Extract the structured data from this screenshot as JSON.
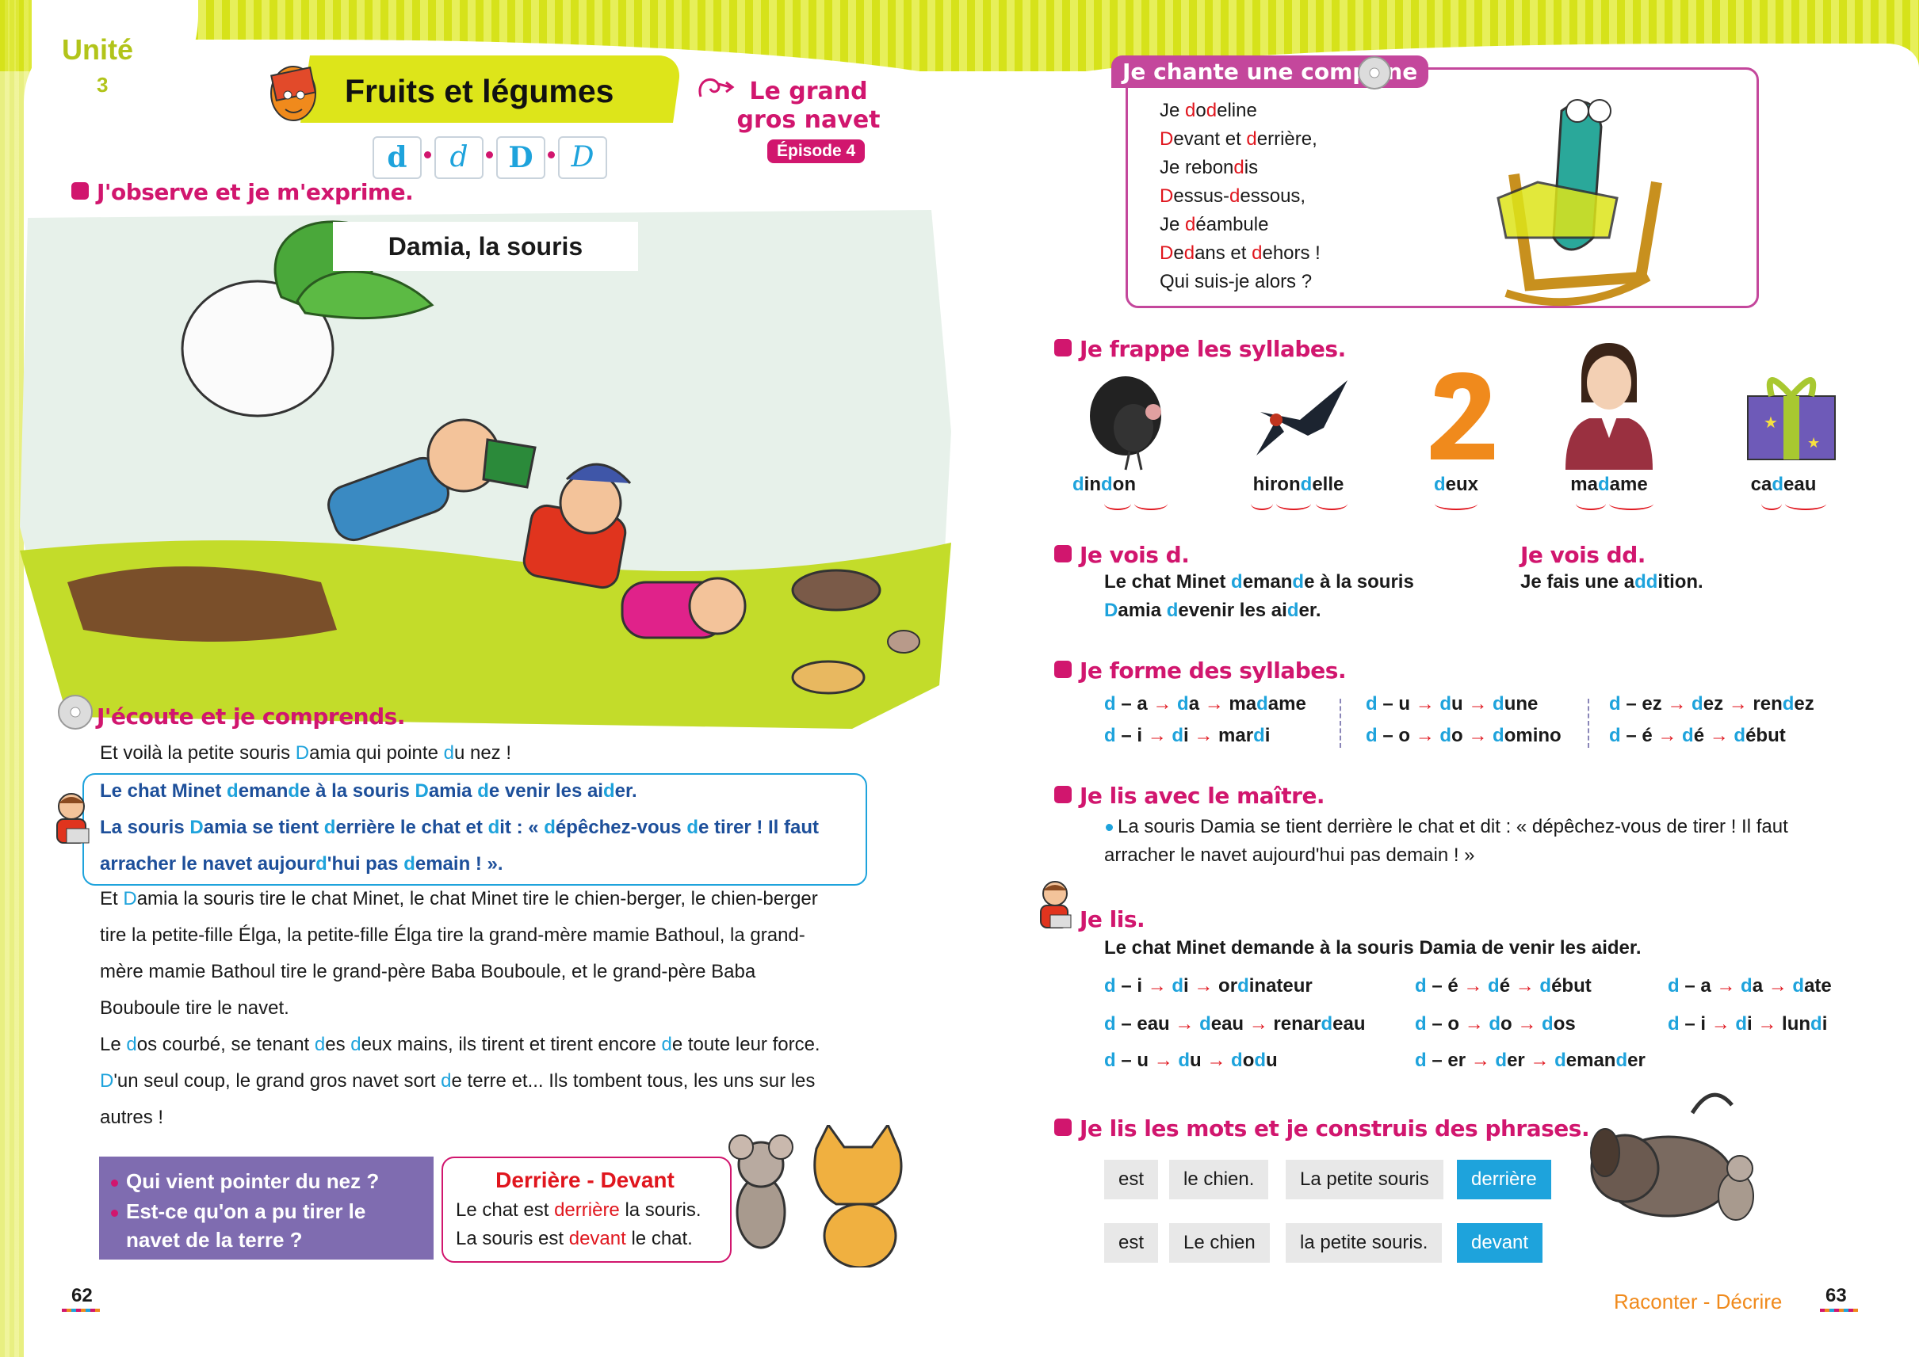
{
  "header": {
    "unit_word": "Unité",
    "unit_number": "3",
    "title": "Fruits et légumes",
    "episode_title": "Le grand gros navet",
    "episode_badge": "Épisode 4",
    "letters": [
      "d",
      "d",
      "D",
      "D"
    ]
  },
  "left": {
    "section_observe": "J'observe et je m'exprime.",
    "scene_title": "Damia, la souris",
    "section_listen": "J'écoute et je comprends.",
    "story_line1": [
      "Et voilà la petite souris ",
      "D",
      "amia qui pointe ",
      "d",
      "u nez !"
    ],
    "highlight": [
      [
        "Le chat Minet ",
        "d",
        "eman",
        "d",
        "e à la souris ",
        "D",
        "amia ",
        "d",
        "e venir les ai",
        "d",
        "er."
      ],
      [
        "La souris ",
        "D",
        "amia se tient ",
        "d",
        "errière le chat et ",
        "d",
        "it : « ",
        "d",
        "épêchez-vous ",
        "d",
        "e tirer ! Il faut"
      ],
      [
        "arracher le navet aujour",
        "d",
        "'hui pas ",
        "d",
        "emain ! »."
      ]
    ],
    "story_rest": [
      [
        "Et ",
        "D",
        "amia la souris tire le chat Minet, le chat Minet tire le chien-berger, le chien-berger"
      ],
      [
        "tire la petite-fille Élga, la petite-fille Élga tire la grand-mère mamie Bathoul, la grand-"
      ],
      [
        "mère mamie Bathoul tire le grand-père Baba Bouboule, et le grand-père Baba"
      ],
      [
        "Bouboule tire le navet."
      ],
      [
        "Le ",
        "d",
        "os courbé, se tenant ",
        "d",
        "es ",
        "d",
        "eux mains, ils tirent et tirent encore ",
        "d",
        "e toute leur force."
      ],
      [
        "D",
        "'un seul coup, le grand gros navet sort ",
        "d",
        "e terre et... Ils tombent tous, les uns sur les"
      ],
      [
        "autres !"
      ]
    ],
    "questions": [
      "Qui vient pointer du nez ?",
      "Est-ce qu'on a pu tirer le",
      "navet de la terre ?"
    ],
    "dd_title": "Derrière - Devant",
    "dd_line1": [
      "Le chat est ",
      "derrière",
      " la souris."
    ],
    "dd_line2": [
      "La souris est ",
      "devant",
      " le chat."
    ],
    "page_number": "62"
  },
  "right": {
    "song_tab": "Je chante une comptine",
    "song": [
      [
        "Je ",
        "d",
        "o",
        "d",
        "eline"
      ],
      [
        "D",
        "evant et ",
        "d",
        "errière,"
      ],
      [
        "Je rebon",
        "d",
        "is"
      ],
      [
        "D",
        "essus-",
        "d",
        "essous,"
      ],
      [
        "Je ",
        "d",
        "éambule"
      ],
      [
        "D",
        "e",
        "d",
        "ans et ",
        "d",
        "ehors !"
      ],
      [
        "Qui suis-je alors ?"
      ]
    ],
    "section_syllables": "Je frappe les syllabes.",
    "words": [
      [
        "",
        "d",
        "in",
        "d",
        "on"
      ],
      [
        "hiron",
        "d",
        "elle"
      ],
      [
        "",
        "d",
        "eux"
      ],
      [
        "ma",
        "d",
        "ame"
      ],
      [
        "ca",
        "d",
        "eau"
      ]
    ],
    "word_icons": [
      "turkey-icon",
      "swallow-icon",
      "number-two-icon",
      "woman-icon",
      "gift-icon"
    ],
    "section_see_d": "Je vois d.",
    "see_d_line1": [
      "Le chat Minet ",
      "d",
      "eman",
      "d",
      "e à la souris"
    ],
    "see_d_line2": [
      "D",
      "amia ",
      "d",
      "evenir les ai",
      "d",
      "er."
    ],
    "section_see_dd": "Je vois dd.",
    "see_dd_line": [
      "Je fais une a",
      "dd",
      "ition."
    ],
    "section_form": "Je forme des syllabes.",
    "form_rows": [
      [
        [
          "d",
          " – a ",
          "→",
          " ",
          "d",
          "a ",
          "→",
          " ma",
          "d",
          "ame"
        ],
        [
          "d",
          " – u ",
          "→",
          " ",
          "d",
          "u ",
          "→",
          " ",
          "d",
          "une"
        ],
        [
          "d",
          " – ez ",
          "→",
          " ",
          "d",
          "ez ",
          "→",
          " ren",
          "d",
          "ez"
        ]
      ],
      [
        [
          "d",
          " – i ",
          "→",
          " ",
          "d",
          "i ",
          "→",
          " mar",
          "d",
          "i"
        ],
        [
          "d",
          " – o ",
          "→",
          " ",
          "d",
          "o ",
          "→",
          " ",
          "d",
          "omino"
        ],
        [
          "d",
          " – é ",
          "→",
          " ",
          "d",
          "é ",
          "→",
          " ",
          "d",
          "ébut"
        ]
      ]
    ],
    "section_read_master": "Je lis avec le maître.",
    "master_text": [
      "La souris Damia se tient derrière le chat et dit : « dépêchez-vous de tirer ! Il faut",
      "arracher le navet aujourd'hui pas demain ! »"
    ],
    "section_read": "Je lis.",
    "read_sentence": "Le chat Minet demande à la souris Damia de venir les aider.",
    "read_grid": [
      [
        [
          "d",
          " – i ",
          "→",
          " ",
          "d",
          "i ",
          "→",
          " or",
          "d",
          "inateur"
        ],
        [
          "d",
          " – é ",
          "→",
          " ",
          "d",
          "é ",
          "→",
          " ",
          "d",
          "ébut"
        ],
        [
          "d",
          " – a ",
          "→",
          " ",
          "d",
          "a ",
          "→",
          " ",
          "d",
          "ate"
        ]
      ],
      [
        [
          "d",
          " – eau ",
          "→",
          " ",
          "d",
          "eau ",
          "→",
          " renar",
          "d",
          "eau"
        ],
        [
          "d",
          " – o ",
          "→",
          " ",
          "d",
          "o ",
          "→",
          " ",
          "d",
          "os"
        ],
        [
          "d",
          " – i ",
          "→",
          " ",
          "d",
          "i ",
          "→",
          " lun",
          "d",
          "i"
        ]
      ],
      [
        [
          "d",
          " – u ",
          "→",
          " ",
          "d",
          "u ",
          "→",
          " ",
          "d",
          "o",
          "d",
          "u"
        ],
        [
          "d",
          " – er ",
          "→",
          " ",
          "d",
          "er ",
          "→",
          " ",
          "d",
          "eman",
          "d",
          "er"
        ],
        null
      ]
    ],
    "section_build": "Je lis les mots et je construis des phrases.",
    "cards_row1": [
      "est",
      "le chien.",
      "La petite souris",
      "derrière"
    ],
    "cards_row2": [
      "est",
      "Le chien",
      "la petite souris.",
      "devant"
    ],
    "footer_label": "Raconter - Décrire",
    "page_number": "63"
  },
  "colors": {
    "accent_lime": "#dde51a",
    "magenta": "#d1166e",
    "blue": "#1ea3dc",
    "red": "#e0161e",
    "purple": "#7f6cb0",
    "orange": "#f08a1c"
  }
}
